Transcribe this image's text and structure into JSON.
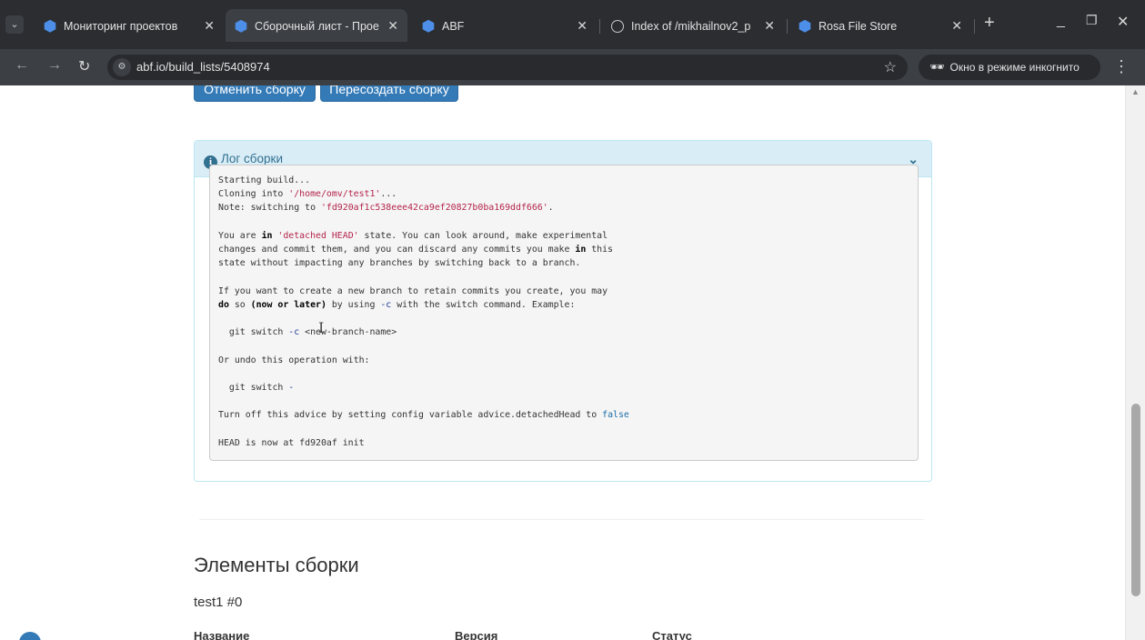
{
  "browser": {
    "tabs": [
      {
        "label": "Мониторинг проектов",
        "icon": "abf-icon",
        "active": false
      },
      {
        "label": "Сборочный лист - Прое",
        "icon": "abf-icon",
        "active": true
      },
      {
        "label": "ABF",
        "icon": "abf-icon",
        "active": false
      },
      {
        "label": "Index of /mikhailnov2_p",
        "icon": "globe-icon",
        "active": false
      },
      {
        "label": "Rosa File Store",
        "icon": "abf-icon",
        "active": false
      }
    ],
    "url": "abf.io/build_lists/5408974",
    "incognito_label": "Окно в режиме инкогнито"
  },
  "page": {
    "buttons": {
      "cancel": "Отменить сборку",
      "rebuild": "Пересоздать сборку"
    },
    "log_panel": {
      "title": "Лог сборки",
      "lines": {
        "l1": "Starting build...",
        "l2a": "Cloning into ",
        "l2s": "'/home/omv/test1'",
        "l2b": "...",
        "l3a": "Note: switching to ",
        "l3s": "'fd920af1c538eee42ca9ef20827b0ba169ddf666'",
        "l3b": ".",
        "l4a": "You are ",
        "l4k": "in",
        "l4s": "'detached HEAD'",
        "l4b": " state. You can look around, make experimental",
        "l5a": "changes and commit them, and you can discard any commits you make ",
        "l5k": "in",
        "l5b": " this",
        "l6": "state without impacting any branches by switching back to a branch.",
        "l7": "If you want to create a new branch to retain commits you create, you may",
        "l8k": "do",
        "l8a": " so ",
        "l8b": "(now or later)",
        "l8c": " by using ",
        "l8o": "-c",
        "l8d": " with the switch command. Example:",
        "l9a": "  git switch ",
        "l9o": "-c",
        "l9b": " <new-branch-name>",
        "l10": "Or undo this operation with:",
        "l11a": "  git switch ",
        "l11o": "-",
        "l12a": "Turn off this advice by setting config variable advice.detachedHead to ",
        "l12f": "false",
        "l13": "HEAD is now at fd920af init"
      }
    },
    "elements_heading": "Элементы сборки",
    "package_label": "test1 #0",
    "table_headers": [
      "Название",
      "Версия",
      "Статус"
    ]
  }
}
